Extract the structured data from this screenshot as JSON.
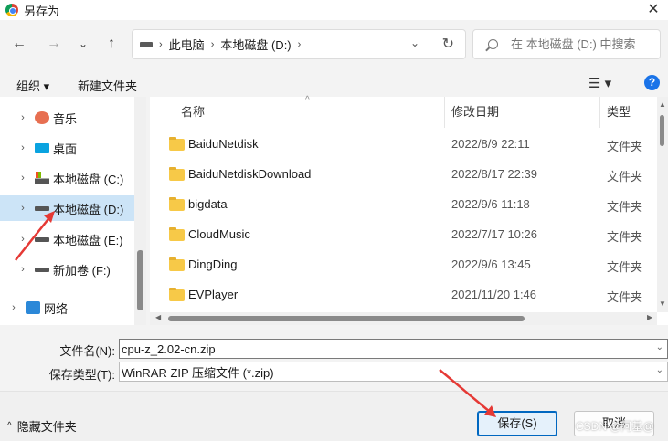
{
  "window": {
    "title": "另存为",
    "close_glyph": "✕"
  },
  "nav": {
    "back_glyph": "←",
    "forward_glyph": "→",
    "recent_glyph": "⌄",
    "up_glyph": "↑",
    "address": {
      "crumbs": [
        "此电脑",
        "本地磁盘 (D:)"
      ],
      "separator": "›",
      "dropdown_glyph": "⌄",
      "refresh_glyph": "↻"
    },
    "search": {
      "placeholder": "在 本地磁盘 (D:) 中搜索"
    }
  },
  "toolbar": {
    "organize_label": "组织 ▾",
    "new_folder_label": "新建文件夹",
    "view_glyph": "☰ ▾",
    "help_glyph": "?"
  },
  "sidebar": {
    "items": [
      {
        "label": "音乐",
        "icon": "music-icon",
        "expanded": false,
        "selected": false
      },
      {
        "label": "桌面",
        "icon": "desktop-icon",
        "expanded": false,
        "selected": false
      },
      {
        "label": "本地磁盘 (C:)",
        "icon": "drive-c-icon",
        "expanded": false,
        "selected": false
      },
      {
        "label": "本地磁盘 (D:)",
        "icon": "drive-icon",
        "expanded": false,
        "selected": true
      },
      {
        "label": "本地磁盘 (E:)",
        "icon": "drive-icon",
        "expanded": false,
        "selected": false
      },
      {
        "label": "新加卷 (F:)",
        "icon": "drive-icon",
        "expanded": false,
        "selected": false
      },
      {
        "label": "网络",
        "icon": "network-icon",
        "expanded": false,
        "selected": false
      }
    ],
    "chevron_glyph": "›"
  },
  "files": {
    "columns": {
      "name": "名称",
      "modified": "修改日期",
      "type": "类型"
    },
    "sort_caret": "^",
    "rows": [
      {
        "name": "BaiduNetdisk",
        "modified": "2022/8/9 22:11",
        "type": "文件夹"
      },
      {
        "name": "BaiduNetdiskDownload",
        "modified": "2022/8/17 22:39",
        "type": "文件夹"
      },
      {
        "name": "bigdata",
        "modified": "2022/9/6 11:18",
        "type": "文件夹"
      },
      {
        "name": "CloudMusic",
        "modified": "2022/7/17 10:26",
        "type": "文件夹"
      },
      {
        "name": "DingDing",
        "modified": "2022/9/6 13:45",
        "type": "文件夹"
      },
      {
        "name": "EVPlayer",
        "modified": "2021/11/20 1:46",
        "type": "文件夹"
      }
    ]
  },
  "fields": {
    "filename_label": "文件名(N):",
    "filename_value": "cpu-z_2.02-cn.zip",
    "filetype_label": "保存类型(T):",
    "filetype_value": "WinRAR ZIP 压缩文件 (*.zip)",
    "dropdown_glyph": "⌄"
  },
  "footer": {
    "hide_folders_label": "隐藏文件夹",
    "hide_folders_caret": "^",
    "save_label": "保存(S)",
    "cancel_label": "取消",
    "watermark": "CSDN @阿基@"
  },
  "colors": {
    "selection": "#cce4f7",
    "primary_border": "#0067c0",
    "annotation_arrow": "#e53935",
    "folder": "#f7c948"
  }
}
